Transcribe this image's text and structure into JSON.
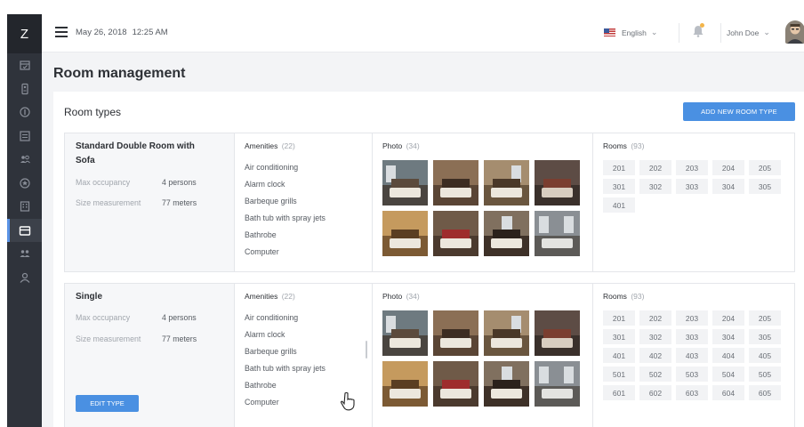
{
  "sidebar": {
    "logo": "Z",
    "items": [
      {
        "icon": "calendar-icon"
      },
      {
        "icon": "key-card-icon"
      },
      {
        "icon": "currency-icon"
      },
      {
        "icon": "report-icon"
      },
      {
        "icon": "guests-icon"
      },
      {
        "icon": "star-badge-icon"
      },
      {
        "icon": "building-icon"
      },
      {
        "icon": "room-card-icon",
        "active": true
      },
      {
        "icon": "staff-icon"
      },
      {
        "icon": "user-icon"
      }
    ]
  },
  "topbar": {
    "date": "May 26, 2018",
    "time": "12:25 AM",
    "language": "English",
    "user_name": "John Doe",
    "notification_dot_color": "#f3b54a"
  },
  "page": {
    "title": "Room management",
    "section_title": "Room types",
    "add_button": "ADD NEW ROOM TYPE"
  },
  "colors": {
    "accent": "#4a90e2",
    "sidebar_bg": "#2f333b"
  },
  "room_types": [
    {
      "name": "Standard Double Room with Sofa",
      "max_occupancy_label": "Max occupancy",
      "max_occupancy_value": "4 persons",
      "size_label": "Size measurement",
      "size_value": "77 meters",
      "amenities_label": "Amenities",
      "amenities_count": "(22)",
      "amenities": [
        "Air conditioning",
        "Alarm clock",
        "Barbeque grills",
        "Bath tub with spray jets",
        "Bathrobe",
        "Computer"
      ],
      "photo_label": "Photo",
      "photo_count": "(34)",
      "rooms_label": "Rooms",
      "rooms_count": "(93)",
      "rooms": [
        "201",
        "202",
        "203",
        "204",
        "205",
        "301",
        "302",
        "303",
        "304",
        "305",
        "401"
      ]
    },
    {
      "name": "Single",
      "max_occupancy_label": "Max occupancy",
      "max_occupancy_value": "4 persons",
      "size_label": "Size measurement",
      "size_value": "77 meters",
      "amenities_label": "Amenities",
      "amenities_count": "(22)",
      "amenities": [
        "Air conditioning",
        "Alarm clock",
        "Barbeque grills",
        "Bath tub with spray jets",
        "Bathrobe",
        "Computer"
      ],
      "photo_label": "Photo",
      "photo_count": "(34)",
      "rooms_label": "Rooms",
      "rooms_count": "(93)",
      "rooms": [
        "201",
        "202",
        "203",
        "204",
        "205",
        "301",
        "302",
        "303",
        "304",
        "305",
        "401",
        "402",
        "403",
        "404",
        "405",
        "501",
        "502",
        "503",
        "504",
        "505",
        "601",
        "602",
        "603",
        "604",
        "605"
      ],
      "edit_button": "EDIT TYPE"
    }
  ]
}
